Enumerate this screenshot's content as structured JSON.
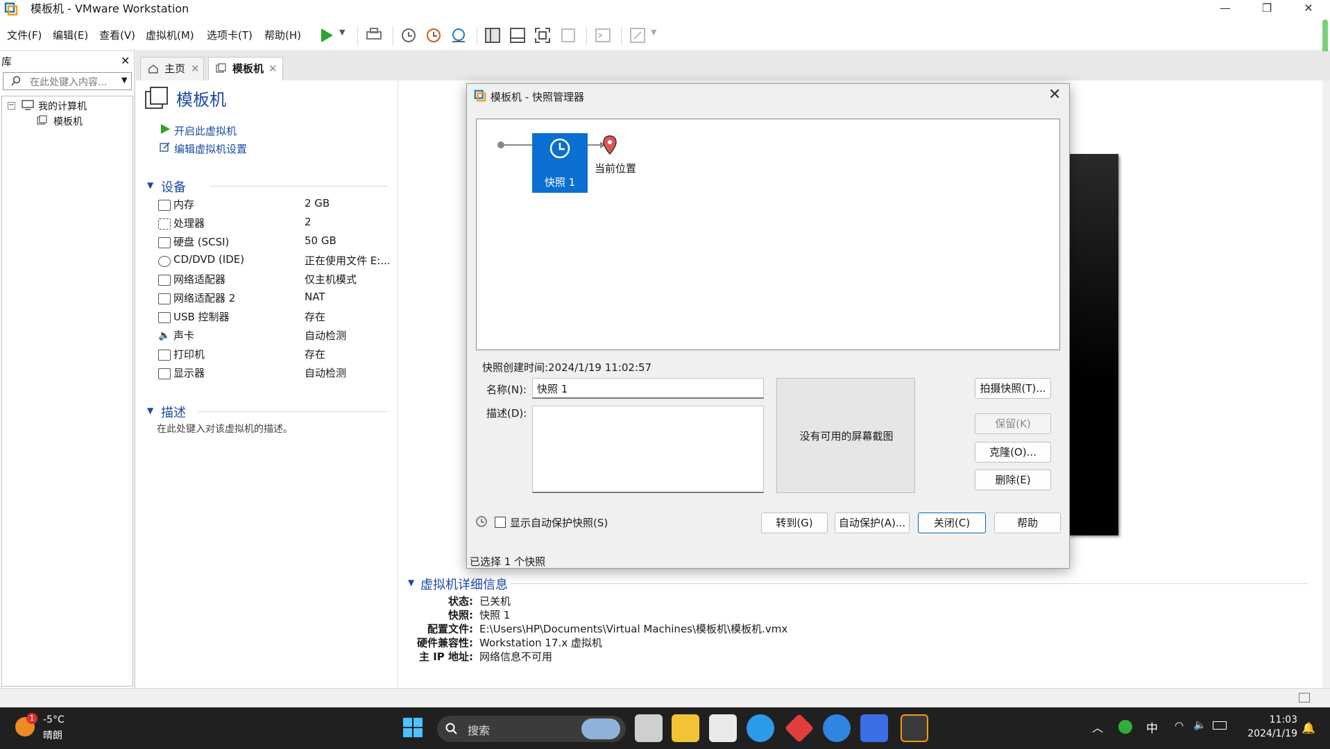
{
  "window": {
    "title": "模板机 - VMware Workstation"
  },
  "menu": [
    "文件(F)",
    "编辑(E)",
    "查看(V)",
    "虚拟机(M)",
    "选项卡(T)",
    "帮助(H)"
  ],
  "library": {
    "title": "库",
    "search_placeholder": "在此处键入内容...",
    "tree": {
      "root": "我的计算机",
      "child": "模板机"
    }
  },
  "tabs": [
    {
      "label": "主页"
    },
    {
      "label": "模板机"
    }
  ],
  "vm": {
    "name": "模板机",
    "actions": {
      "start": "开启此虚拟机",
      "edit": "编辑虚拟机设置"
    },
    "devices_title": "设备",
    "devices": [
      {
        "label": "内存",
        "value": "2 GB",
        "icon": "memory-icon"
      },
      {
        "label": "处理器",
        "value": "2",
        "icon": "cpu-icon"
      },
      {
        "label": "硬盘 (SCSI)",
        "value": "50 GB",
        "icon": "disk-icon"
      },
      {
        "label": "CD/DVD (IDE)",
        "value": "正在使用文件 E:...",
        "icon": "cd-icon"
      },
      {
        "label": "网络适配器",
        "value": "仅主机模式",
        "icon": "network-icon"
      },
      {
        "label": "网络适配器 2",
        "value": "NAT",
        "icon": "network-icon"
      },
      {
        "label": "USB 控制器",
        "value": "存在",
        "icon": "usb-icon"
      },
      {
        "label": "声卡",
        "value": "自动检测",
        "icon": "sound-icon"
      },
      {
        "label": "打印机",
        "value": "存在",
        "icon": "printer-icon"
      },
      {
        "label": "显示器",
        "value": "自动检测",
        "icon": "monitor-icon"
      }
    ],
    "description_title": "描述",
    "description_placeholder": "在此处键入对该虚拟机的描述。",
    "details_title": "虚拟机详细信息",
    "details": [
      {
        "key": "状态:",
        "value": "已关机"
      },
      {
        "key": "快照:",
        "value": "快照 1"
      },
      {
        "key": "配置文件:",
        "value": "E:\\Users\\HP\\Documents\\Virtual Machines\\模板机\\模板机.vmx"
      },
      {
        "key": "硬件兼容性:",
        "value": "Workstation 17.x 虚拟机"
      },
      {
        "key": "主 IP 地址:",
        "value": "网络信息不可用"
      }
    ]
  },
  "dialog": {
    "title": "模板机 - 快照管理器",
    "snapshot_node": "快照 1",
    "current_position": "当前位置",
    "created_time": "快照创建时间:2024/1/19 11:02:57",
    "name_label": "名称(N):",
    "name_value": "快照 1",
    "desc_label": "描述(D):",
    "no_screenshot": "没有可用的屏幕截图",
    "buttons": {
      "take": "拍摄快照(T)...",
      "keep": "保留(K)",
      "clone": "克隆(O)...",
      "delete": "删除(E)",
      "goto": "转到(G)",
      "autoprotect": "自动保护(A)...",
      "close": "关闭(C)",
      "help": "帮助"
    },
    "show_autoprotect": "显示自动保护快照(S)",
    "status": "已选择 1 个快照"
  },
  "taskbar": {
    "weather_temp": "-5°C",
    "weather_text": "晴朗",
    "weather_badge": "1",
    "search_label": "搜索",
    "ime": "中",
    "time": "11:03",
    "date": "2024/1/19"
  },
  "colors": {
    "accent": "#0a6fd1",
    "link": "#1b4aa6",
    "play": "#2aa52a",
    "pin": "#e05555"
  }
}
